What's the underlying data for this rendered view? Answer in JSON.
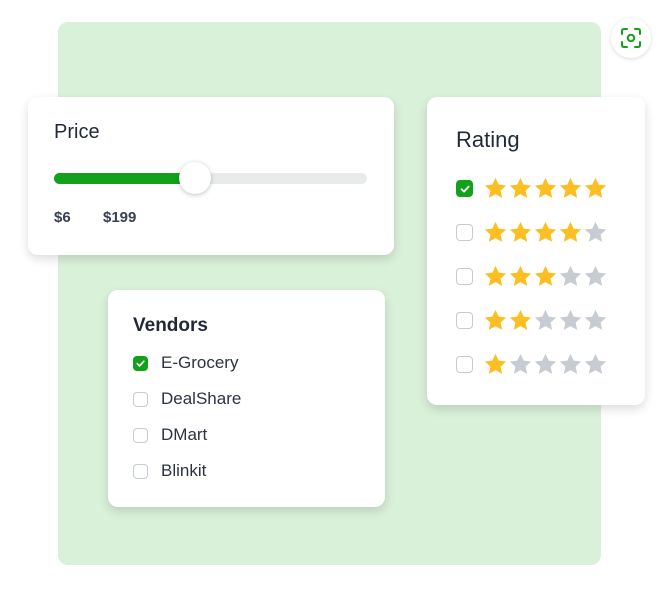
{
  "colors": {
    "background_panel": "#d9f0d9",
    "accent_green": "#13a11b",
    "star_filled": "#fbbf24",
    "star_empty": "#c7ccd2"
  },
  "toolbar": {
    "scan_icon": "scan-focus-icon"
  },
  "price": {
    "title": "Price",
    "min_label": "$6",
    "max_label": "$199",
    "slider_fill_fraction": 0.45
  },
  "rating": {
    "title": "Rating",
    "options": [
      {
        "stars": 5,
        "checked": true
      },
      {
        "stars": 4,
        "checked": false
      },
      {
        "stars": 3,
        "checked": false
      },
      {
        "stars": 2,
        "checked": false
      },
      {
        "stars": 1,
        "checked": false
      }
    ]
  },
  "vendors": {
    "title": "Vendors",
    "items": [
      {
        "label": "E-Grocery",
        "checked": true
      },
      {
        "label": "DealShare",
        "checked": false
      },
      {
        "label": "DMart",
        "checked": false
      },
      {
        "label": "Blinkit",
        "checked": false
      }
    ]
  }
}
